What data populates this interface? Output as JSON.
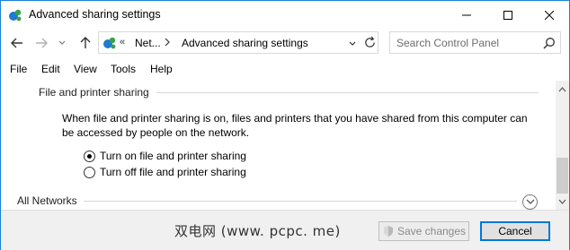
{
  "window": {
    "title": "Advanced sharing settings",
    "accent": "#1883d7"
  },
  "nav": {
    "back_icon": "arrow-left-icon",
    "forward_icon": "arrow-right-icon",
    "up_icon": "arrow-up-icon"
  },
  "address": {
    "chevron": "«",
    "crumb1": "Net...",
    "crumb2": "Advanced sharing settings"
  },
  "search": {
    "placeholder": "Search Control Panel"
  },
  "menu": {
    "file": "File",
    "edit": "Edit",
    "view": "View",
    "tools": "Tools",
    "help": "Help"
  },
  "content": {
    "section_title": "File and printer sharing",
    "description": "When file and printer sharing is on, files and printers that you have shared from this computer can be accessed by people on the network.",
    "radio_on_label": "Turn on file and printer sharing",
    "radio_off_label": "Turn off file and printer sharing",
    "selected": "on",
    "all_networks": "All Networks"
  },
  "footer": {
    "watermark": "双电网 (www. pcpc. me)",
    "save_label": "Save changes",
    "cancel_label": "Cancel"
  }
}
